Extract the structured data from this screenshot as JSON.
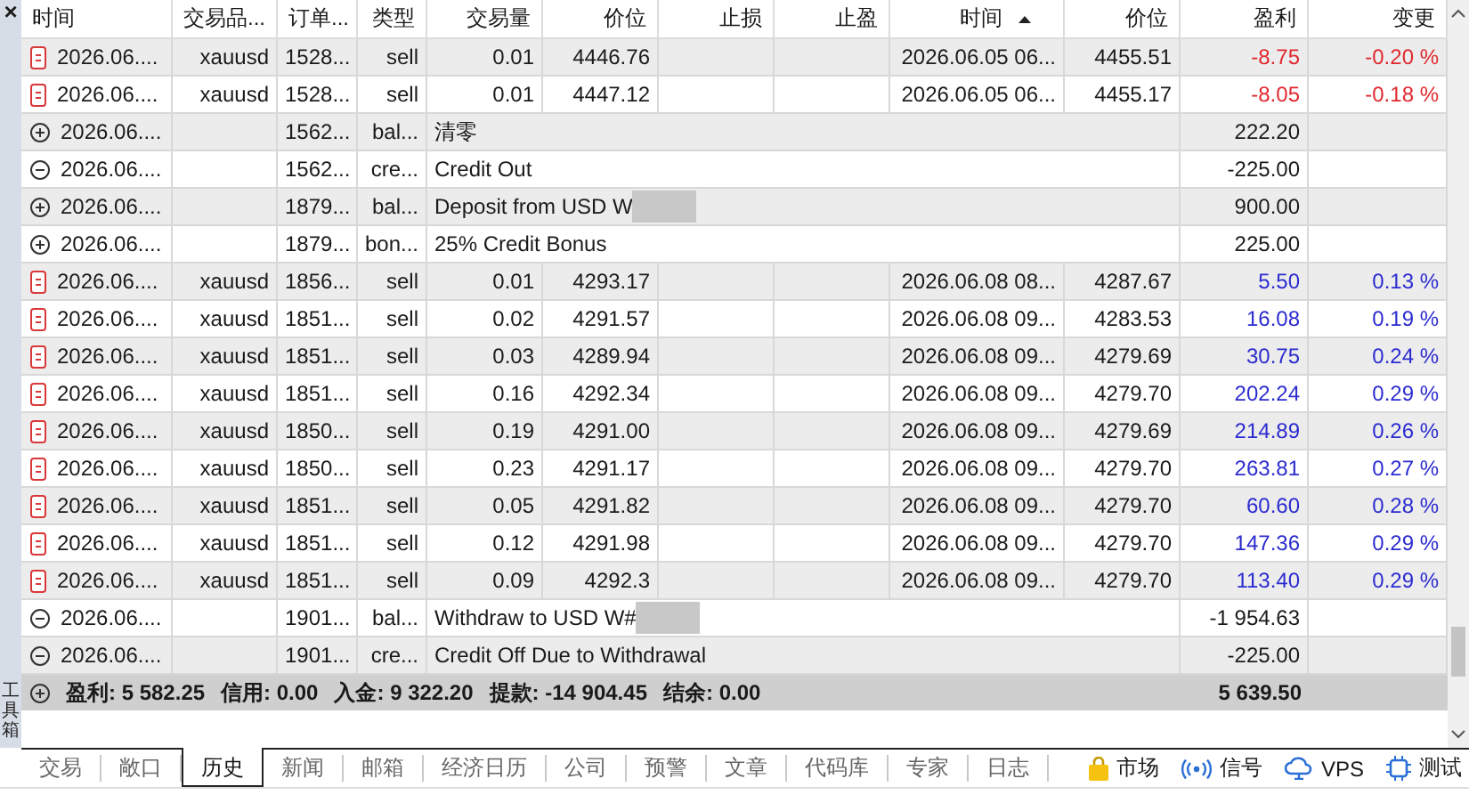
{
  "toolbox": {
    "close": "×",
    "title": "工具箱"
  },
  "columns": [
    {
      "label": "时间",
      "sorted": false
    },
    {
      "label": "交易品...",
      "sorted": false
    },
    {
      "label": "订单...",
      "sorted": false
    },
    {
      "label": "类型",
      "sorted": false
    },
    {
      "label": "交易量",
      "sorted": false
    },
    {
      "label": "价位",
      "sorted": false
    },
    {
      "label": "止损",
      "sorted": false
    },
    {
      "label": "止盈",
      "sorted": false
    },
    {
      "label": "时间",
      "sorted": true
    },
    {
      "label": "价位",
      "sorted": false
    },
    {
      "label": "盈利",
      "sorted": false
    },
    {
      "label": "变更",
      "sorted": false
    }
  ],
  "rows": [
    {
      "kind": "deal",
      "time": "2026.06....",
      "symbol": "xauusd",
      "order": "1528...",
      "type": "sell",
      "volume": "0.01",
      "price": "4446.76",
      "close_time": "2026.06.05 06...",
      "close_price": "4455.51",
      "profit": "-8.75",
      "change": "-0.20 %",
      "color": "#e0282e"
    },
    {
      "kind": "deal",
      "time": "2026.06....",
      "symbol": "xauusd",
      "order": "1528...",
      "type": "sell",
      "volume": "0.01",
      "price": "4447.12",
      "close_time": "2026.06.05 06...",
      "close_price": "4455.17",
      "profit": "-8.05",
      "change": "-0.18 %",
      "color": "#e0282e"
    },
    {
      "kind": "plus",
      "time": "2026.06....",
      "order": "1562...",
      "type": "bal...",
      "comment": "清零",
      "profit": "222.20"
    },
    {
      "kind": "minus",
      "time": "2026.06....",
      "order": "1562...",
      "type": "cre...",
      "comment": "Credit Out",
      "profit": "-225.00"
    },
    {
      "kind": "plus",
      "time": "2026.06....",
      "order": "1879...",
      "type": "bal...",
      "comment": "Deposit from USD W",
      "profit": "900.00",
      "redacted": true
    },
    {
      "kind": "plus",
      "time": "2026.06....",
      "order": "1879...",
      "type": "bon...",
      "comment": "25% Credit Bonus",
      "profit": "225.00"
    },
    {
      "kind": "deal",
      "time": "2026.06....",
      "symbol": "xauusd",
      "order": "1856...",
      "type": "sell",
      "volume": "0.01",
      "price": "4293.17",
      "close_time": "2026.06.08 08...",
      "close_price": "4287.67",
      "profit": "5.50",
      "change": "0.13 %",
      "color": "#2b2bd0"
    },
    {
      "kind": "deal",
      "time": "2026.06....",
      "symbol": "xauusd",
      "order": "1851...",
      "type": "sell",
      "volume": "0.02",
      "price": "4291.57",
      "close_time": "2026.06.08 09...",
      "close_price": "4283.53",
      "profit": "16.08",
      "change": "0.19 %",
      "color": "#2b2bd0"
    },
    {
      "kind": "deal",
      "time": "2026.06....",
      "symbol": "xauusd",
      "order": "1851...",
      "type": "sell",
      "volume": "0.03",
      "price": "4289.94",
      "close_time": "2026.06.08 09...",
      "close_price": "4279.69",
      "profit": "30.75",
      "change": "0.24 %",
      "color": "#2b2bd0"
    },
    {
      "kind": "deal",
      "time": "2026.06....",
      "symbol": "xauusd",
      "order": "1851...",
      "type": "sell",
      "volume": "0.16",
      "price": "4292.34",
      "close_time": "2026.06.08 09...",
      "close_price": "4279.70",
      "profit": "202.24",
      "change": "0.29 %",
      "color": "#2b2bd0"
    },
    {
      "kind": "deal",
      "time": "2026.06....",
      "symbol": "xauusd",
      "order": "1850...",
      "type": "sell",
      "volume": "0.19",
      "price": "4291.00",
      "close_time": "2026.06.08 09...",
      "close_price": "4279.69",
      "profit": "214.89",
      "change": "0.26 %",
      "color": "#2b2bd0"
    },
    {
      "kind": "deal",
      "time": "2026.06....",
      "symbol": "xauusd",
      "order": "1850...",
      "type": "sell",
      "volume": "0.23",
      "price": "4291.17",
      "close_time": "2026.06.08 09...",
      "close_price": "4279.70",
      "profit": "263.81",
      "change": "0.27 %",
      "color": "#2b2bd0"
    },
    {
      "kind": "deal",
      "time": "2026.06....",
      "symbol": "xauusd",
      "order": "1851...",
      "type": "sell",
      "volume": "0.05",
      "price": "4291.82",
      "close_time": "2026.06.08 09...",
      "close_price": "4279.70",
      "profit": "60.60",
      "change": "0.28 %",
      "color": "#2b2bd0"
    },
    {
      "kind": "deal",
      "time": "2026.06....",
      "symbol": "xauusd",
      "order": "1851...",
      "type": "sell",
      "volume": "0.12",
      "price": "4291.98",
      "close_time": "2026.06.08 09...",
      "close_price": "4279.70",
      "profit": "147.36",
      "change": "0.29 %",
      "color": "#2b2bd0"
    },
    {
      "kind": "deal",
      "time": "2026.06....",
      "symbol": "xauusd",
      "order": "1851...",
      "type": "sell",
      "volume": "0.09",
      "price": "4292.3",
      "close_time": "2026.06.08 09...",
      "close_price": "4279.70",
      "profit": "113.40",
      "change": "0.29 %",
      "color": "#2b2bd0"
    },
    {
      "kind": "minus",
      "time": "2026.06....",
      "order": "1901...",
      "type": "bal...",
      "comment": "Withdraw to USD W#",
      "profit": "-1 954.63",
      "redacted": true
    },
    {
      "kind": "minus",
      "time": "2026.06....",
      "order": "1901...",
      "type": "cre...",
      "comment": "Credit Off Due to Withdrawal",
      "profit": "-225.00"
    }
  ],
  "summary": {
    "items": [
      "盈利: 5 582.25",
      "信用: 0.00",
      "入金: 9 322.20",
      "提款: -14 904.45",
      "结余: 0.00"
    ],
    "total": "5 639.50"
  },
  "tabs": [
    {
      "label": "交易",
      "selected": false
    },
    {
      "label": "敞口",
      "selected": false
    },
    {
      "label": "历史",
      "selected": true
    },
    {
      "label": "新闻",
      "selected": false
    },
    {
      "label": "邮箱",
      "selected": false
    },
    {
      "label": "经济日历",
      "selected": false
    },
    {
      "label": "公司",
      "selected": false
    },
    {
      "label": "预警",
      "selected": false
    },
    {
      "label": "文章",
      "selected": false
    },
    {
      "label": "代码库",
      "selected": false
    },
    {
      "label": "专家",
      "selected": false
    },
    {
      "label": "日志",
      "selected": false
    }
  ],
  "services": [
    {
      "kind": "market",
      "label": "市场"
    },
    {
      "kind": "signal",
      "label": "信号"
    },
    {
      "kind": "vps",
      "label": "VPS"
    },
    {
      "kind": "test",
      "label": "测试"
    }
  ]
}
